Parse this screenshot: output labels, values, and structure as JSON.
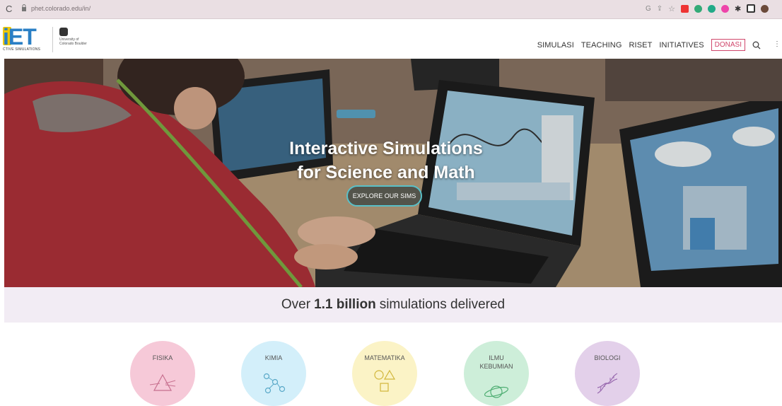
{
  "browser": {
    "url": "phet.colorado.edu/in/",
    "ext_colors": [
      "#e33",
      "#3a7",
      "#2a8",
      "#e4a",
      "#333",
      "#333",
      "#333"
    ]
  },
  "header": {
    "logo_text": "iET",
    "logo_subtext": "CTIVE SIMULATIONS",
    "university": "University of Colorado Boulder",
    "nav": [
      "SIMULASI",
      "TEACHING",
      "RISET",
      "INITIATIVES"
    ],
    "donate": "DONASI",
    "more": "⋮"
  },
  "hero": {
    "title_line1": "Interactive Simulations",
    "title_line2": "for Science and Math",
    "button": "EXPLORE OUR SIMS"
  },
  "banner": {
    "prefix": "Over",
    "highlight": "1.1 billion",
    "suffix": "simulations delivered"
  },
  "categories": [
    {
      "label_lines": [
        "FISIKA"
      ],
      "color": "#f6c9d8",
      "icon": "prism-icon"
    },
    {
      "label_lines": [
        "KIMIA"
      ],
      "color": "#d3effa",
      "icon": "molecule-icon"
    },
    {
      "label_lines": [
        "MATEMATIKA"
      ],
      "color": "#fbf3c6",
      "icon": "shapes-icon"
    },
    {
      "label_lines": [
        "ILMU",
        "KEBUMIAN"
      ],
      "color": "#cdeed9",
      "icon": "planet-icon"
    },
    {
      "label_lines": [
        "BIOLOGI"
      ],
      "color": "#e3d0ea",
      "icon": "dna-icon"
    }
  ],
  "colors": {
    "accent_teal": "#59c0c8",
    "donate_pink": "#d0466b",
    "phet_blue": "#2a7fc5"
  }
}
